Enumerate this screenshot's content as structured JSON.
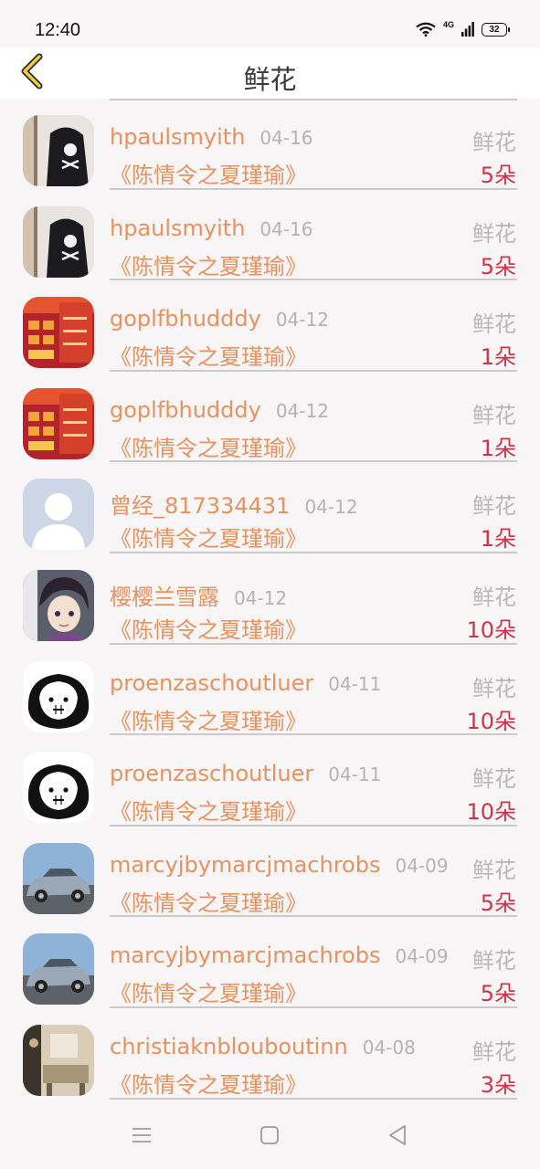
{
  "status_bar": {
    "time": "12:40",
    "network": "4G",
    "battery": "32"
  },
  "header": {
    "title": "鲜花"
  },
  "colors": {
    "accent": "#e7925f",
    "count": "#d0344a",
    "muted": "#b8b8b8"
  },
  "items": [
    {
      "username": "hpaulsmyith",
      "date": "04-16",
      "book": "《陈情令之夏瑾瑜》",
      "gift": "鲜花",
      "count": "5朵",
      "avatar_icon": "skull-shirt-avatar"
    },
    {
      "username": "hpaulsmyith",
      "date": "04-16",
      "book": "《陈情令之夏瑾瑜》",
      "gift": "鲜花",
      "count": "5朵",
      "avatar_icon": "skull-shirt-avatar"
    },
    {
      "username": "goplfbhudddy",
      "date": "04-12",
      "book": "《陈情令之夏瑾瑜》",
      "gift": "鲜花",
      "count": "1朵",
      "avatar_icon": "php-poster-avatar"
    },
    {
      "username": "goplfbhudddy",
      "date": "04-12",
      "book": "《陈情令之夏瑾瑜》",
      "gift": "鲜花",
      "count": "1朵",
      "avatar_icon": "php-poster-avatar"
    },
    {
      "username": "曾经_817334431",
      "date": "04-12",
      "book": "《陈情令之夏瑾瑜》",
      "gift": "鲜花",
      "count": "1朵",
      "avatar_icon": "default-person-avatar"
    },
    {
      "username": "樱樱兰雪露",
      "date": "04-12",
      "book": "《陈情令之夏瑾瑜》",
      "gift": "鲜花",
      "count": "10朵",
      "avatar_icon": "anime-character-avatar"
    },
    {
      "username": "proenzaschoutluer",
      "date": "04-11",
      "book": "《陈情令之夏瑾瑜》",
      "gift": "鲜花",
      "count": "10朵",
      "avatar_icon": "cartoon-face-avatar"
    },
    {
      "username": "proenzaschoutluer",
      "date": "04-11",
      "book": "《陈情令之夏瑾瑜》",
      "gift": "鲜花",
      "count": "10朵",
      "avatar_icon": "cartoon-face-avatar"
    },
    {
      "username": "marcyjbymarcjmachrobs",
      "date": "04-09",
      "book": "《陈情令之夏瑾瑜》",
      "gift": "鲜花",
      "count": "5朵",
      "avatar_icon": "car-photo-avatar"
    },
    {
      "username": "marcyjbymarcjmachrobs",
      "date": "04-09",
      "book": "《陈情令之夏瑾瑜》",
      "gift": "鲜花",
      "count": "5朵",
      "avatar_icon": "car-photo-avatar"
    },
    {
      "username": "christiaknblouboutinn",
      "date": "04-08",
      "book": "《陈情令之夏瑾瑜》",
      "gift": "鲜花",
      "count": "3朵",
      "avatar_icon": "room-photo-avatar"
    }
  ]
}
